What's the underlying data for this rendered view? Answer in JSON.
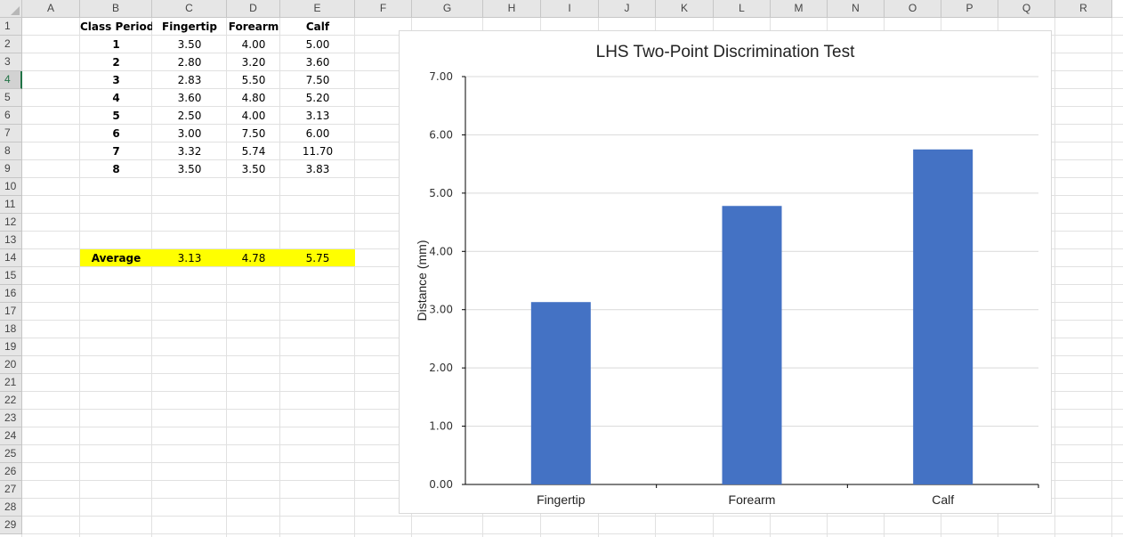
{
  "spreadsheet": {
    "columns": [
      "A",
      "B",
      "C",
      "D",
      "E",
      "F",
      "G",
      "H",
      "I",
      "J",
      "K",
      "L",
      "M",
      "N",
      "O",
      "P",
      "Q",
      "R"
    ],
    "rows": [
      "1",
      "2",
      "3",
      "4",
      "5",
      "6",
      "7",
      "8",
      "9",
      "10",
      "11",
      "12",
      "13",
      "14",
      "15",
      "16",
      "17",
      "18",
      "19",
      "20",
      "21",
      "22",
      "23",
      "24",
      "25",
      "26",
      "27",
      "28",
      "29"
    ],
    "selected_row": "4",
    "table": {
      "headers": [
        "Class Period",
        "Fingertip",
        "Forearm",
        "Calf"
      ],
      "data": [
        [
          "1",
          "3.50",
          "4.00",
          "5.00"
        ],
        [
          "2",
          "2.80",
          "3.20",
          "3.60"
        ],
        [
          "3",
          "2.83",
          "5.50",
          "7.50"
        ],
        [
          "4",
          "3.60",
          "4.80",
          "5.20"
        ],
        [
          "5",
          "2.50",
          "4.00",
          "3.13"
        ],
        [
          "6",
          "3.00",
          "7.50",
          "6.00"
        ],
        [
          "7",
          "3.32",
          "5.74",
          "11.70"
        ],
        [
          "8",
          "3.50",
          "3.50",
          "3.83"
        ]
      ],
      "average": {
        "label": "Average",
        "values": [
          "3.13",
          "4.78",
          "5.75"
        ]
      }
    },
    "colors": {
      "highlight": "#ffff00",
      "bar": "#4472c4",
      "selection": "#217346"
    }
  },
  "chart_data": {
    "type": "bar",
    "title": "LHS Two-Point Discrimination Test",
    "xlabel": "",
    "ylabel": "Distance (mm)",
    "categories": [
      "Fingertip",
      "Forearm",
      "Calf"
    ],
    "values": [
      3.13,
      4.78,
      5.75
    ],
    "ylim": [
      0,
      7
    ],
    "yticks": [
      "0.00",
      "1.00",
      "2.00",
      "3.00",
      "4.00",
      "5.00",
      "6.00",
      "7.00"
    ],
    "grid": true,
    "legend": "none",
    "color": "#4472c4"
  }
}
